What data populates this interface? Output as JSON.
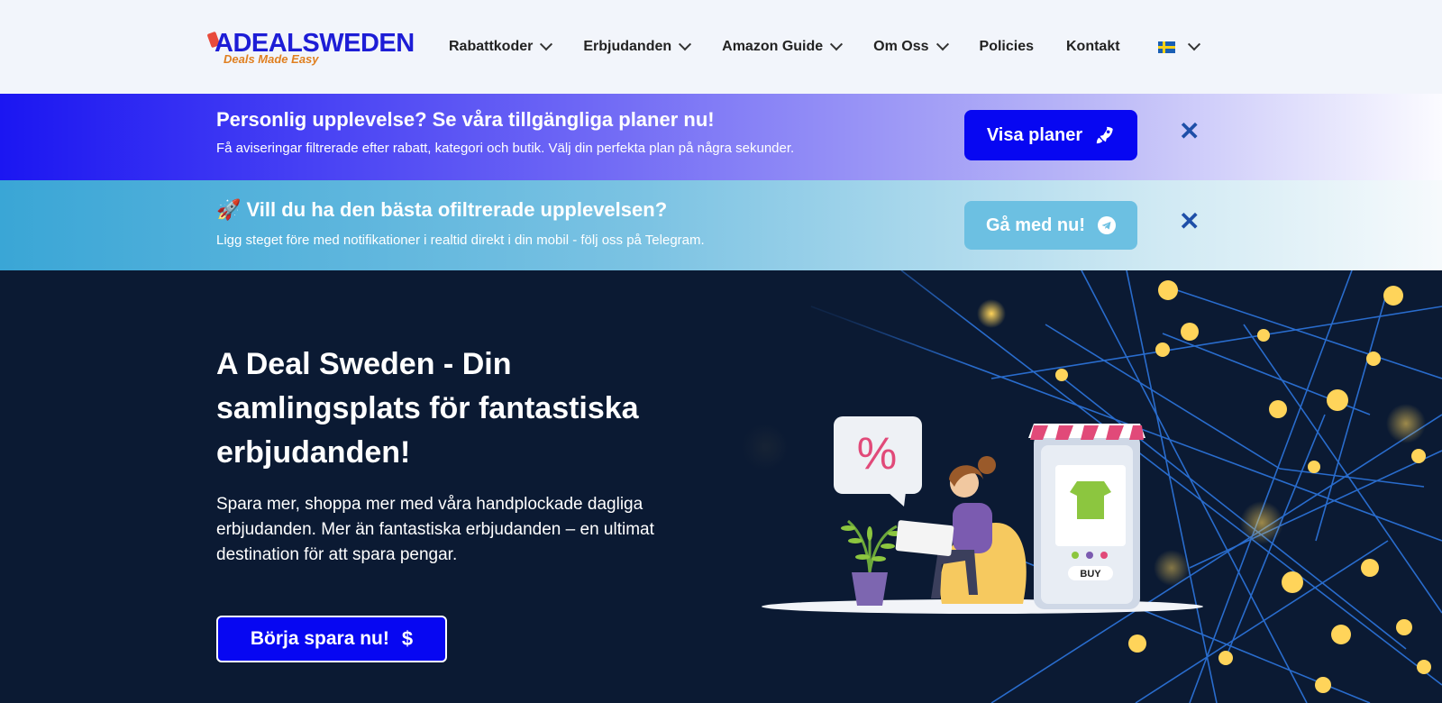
{
  "nav": {
    "logo_text": "ADEALSWEDEN",
    "logo_tagline": "Deals Made Easy",
    "items": [
      {
        "label": "Rabattkoder",
        "dropdown": true
      },
      {
        "label": "Erbjudanden",
        "dropdown": true
      },
      {
        "label": "Amazon Guide",
        "dropdown": true
      },
      {
        "label": "Om Oss",
        "dropdown": true
      },
      {
        "label": "Policies",
        "dropdown": false
      },
      {
        "label": "Kontakt",
        "dropdown": false
      }
    ]
  },
  "banner_plans": {
    "title": "Personlig upplevelse? Se våra tillgängliga planer nu!",
    "subtitle": "Få aviseringar filtrerade efter rabatt, kategori och butik. Välj din perfekta plan på några sekunder.",
    "button_label": "Visa planer",
    "close_icon": "close-icon"
  },
  "banner_telegram": {
    "emoji": "🚀",
    "title": "Vill du ha den bästa ofiltrerade upplevelsen?",
    "subtitle": "Ligg steget före med notifikationer i realtid direkt i din mobil - följ oss på Telegram.",
    "button_label": "Gå med nu!",
    "close_icon": "close-icon"
  },
  "hero": {
    "title": "A Deal Sweden - Din samlingsplats för fantastiska erbjudanden!",
    "text": "Spara mer, shoppa mer med våra handplockade dagliga erbjudanden. Mer än fantastiska erbjudanden – en ultimat destination för att spara pengar.",
    "cta_label": "Börja spara nu!",
    "illustration": {
      "percent_sign": "%",
      "buy_label": "BUY"
    }
  },
  "colors": {
    "accent": "#0707f2",
    "nav_bg": "#f2f5fb",
    "hero_bg": "#0b1a33",
    "close": "#1e4fa8"
  }
}
